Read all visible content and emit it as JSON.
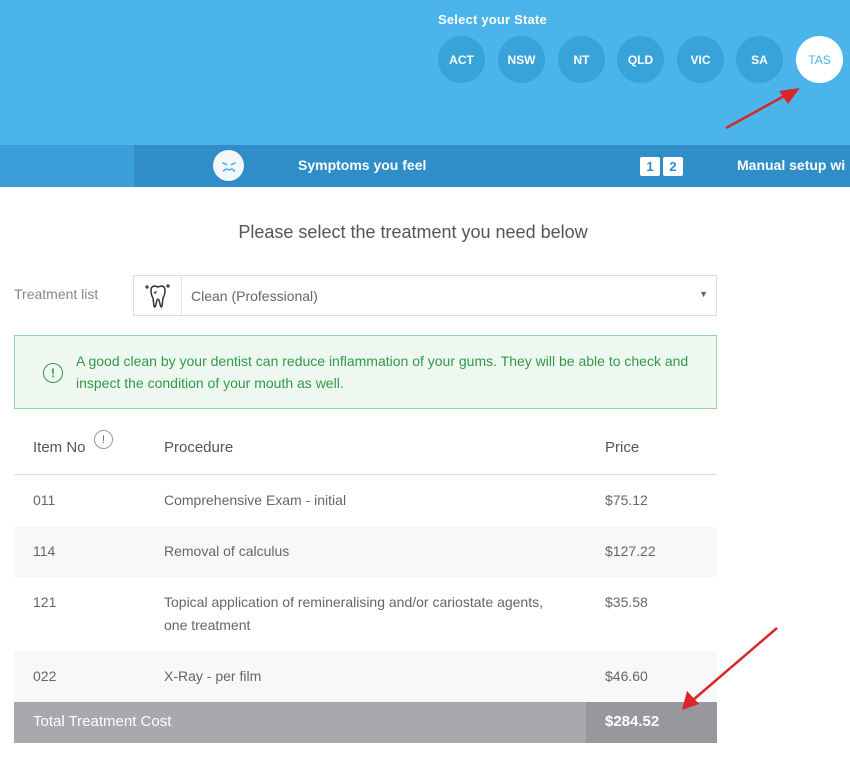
{
  "header": {
    "state_title": "Select your State",
    "states": [
      "ACT",
      "NSW",
      "NT",
      "QLD",
      "VIC",
      "SA",
      "TAS"
    ],
    "selected_state": "TAS"
  },
  "steps": {
    "symptoms_label": "Symptoms you feel",
    "symptoms_icon": "sad-face-icon",
    "manual_icon_digits": [
      "1",
      "2"
    ],
    "manual_label": "Manual setup wi"
  },
  "main": {
    "heading": "Please select the treatment you need below",
    "treatment_list_label": "Treatment list",
    "treatment_selected": "Clean (Professional)",
    "alert_text": "A good clean by your dentist can reduce inflammation of your gums. They will be able to check and inspect the condition of your mouth as well.",
    "alert_icon": "!",
    "info_icon": "!"
  },
  "table": {
    "headers": {
      "item": "Item No",
      "procedure": "Procedure",
      "price": "Price"
    },
    "rows": [
      {
        "item": "011",
        "procedure": "Comprehensive Exam - initial",
        "price": "$75.12"
      },
      {
        "item": "114",
        "procedure": "Removal of calculus",
        "price": "$127.22"
      },
      {
        "item": "121",
        "procedure": "Topical application of remineralising and/or cariostate agents, one treatment",
        "price": "$35.58"
      },
      {
        "item": "022",
        "procedure": "X-Ray - per film",
        "price": "$46.60"
      }
    ],
    "total_label": "Total Treatment Cost",
    "total_value": "$284.52"
  },
  "colors": {
    "header_blue": "#4bb4ea",
    "pill_blue": "#37a3d8",
    "step_blue": "#2f8dc7",
    "alert_green": "#2f9a4a",
    "annotation_red": "#d8262a"
  }
}
